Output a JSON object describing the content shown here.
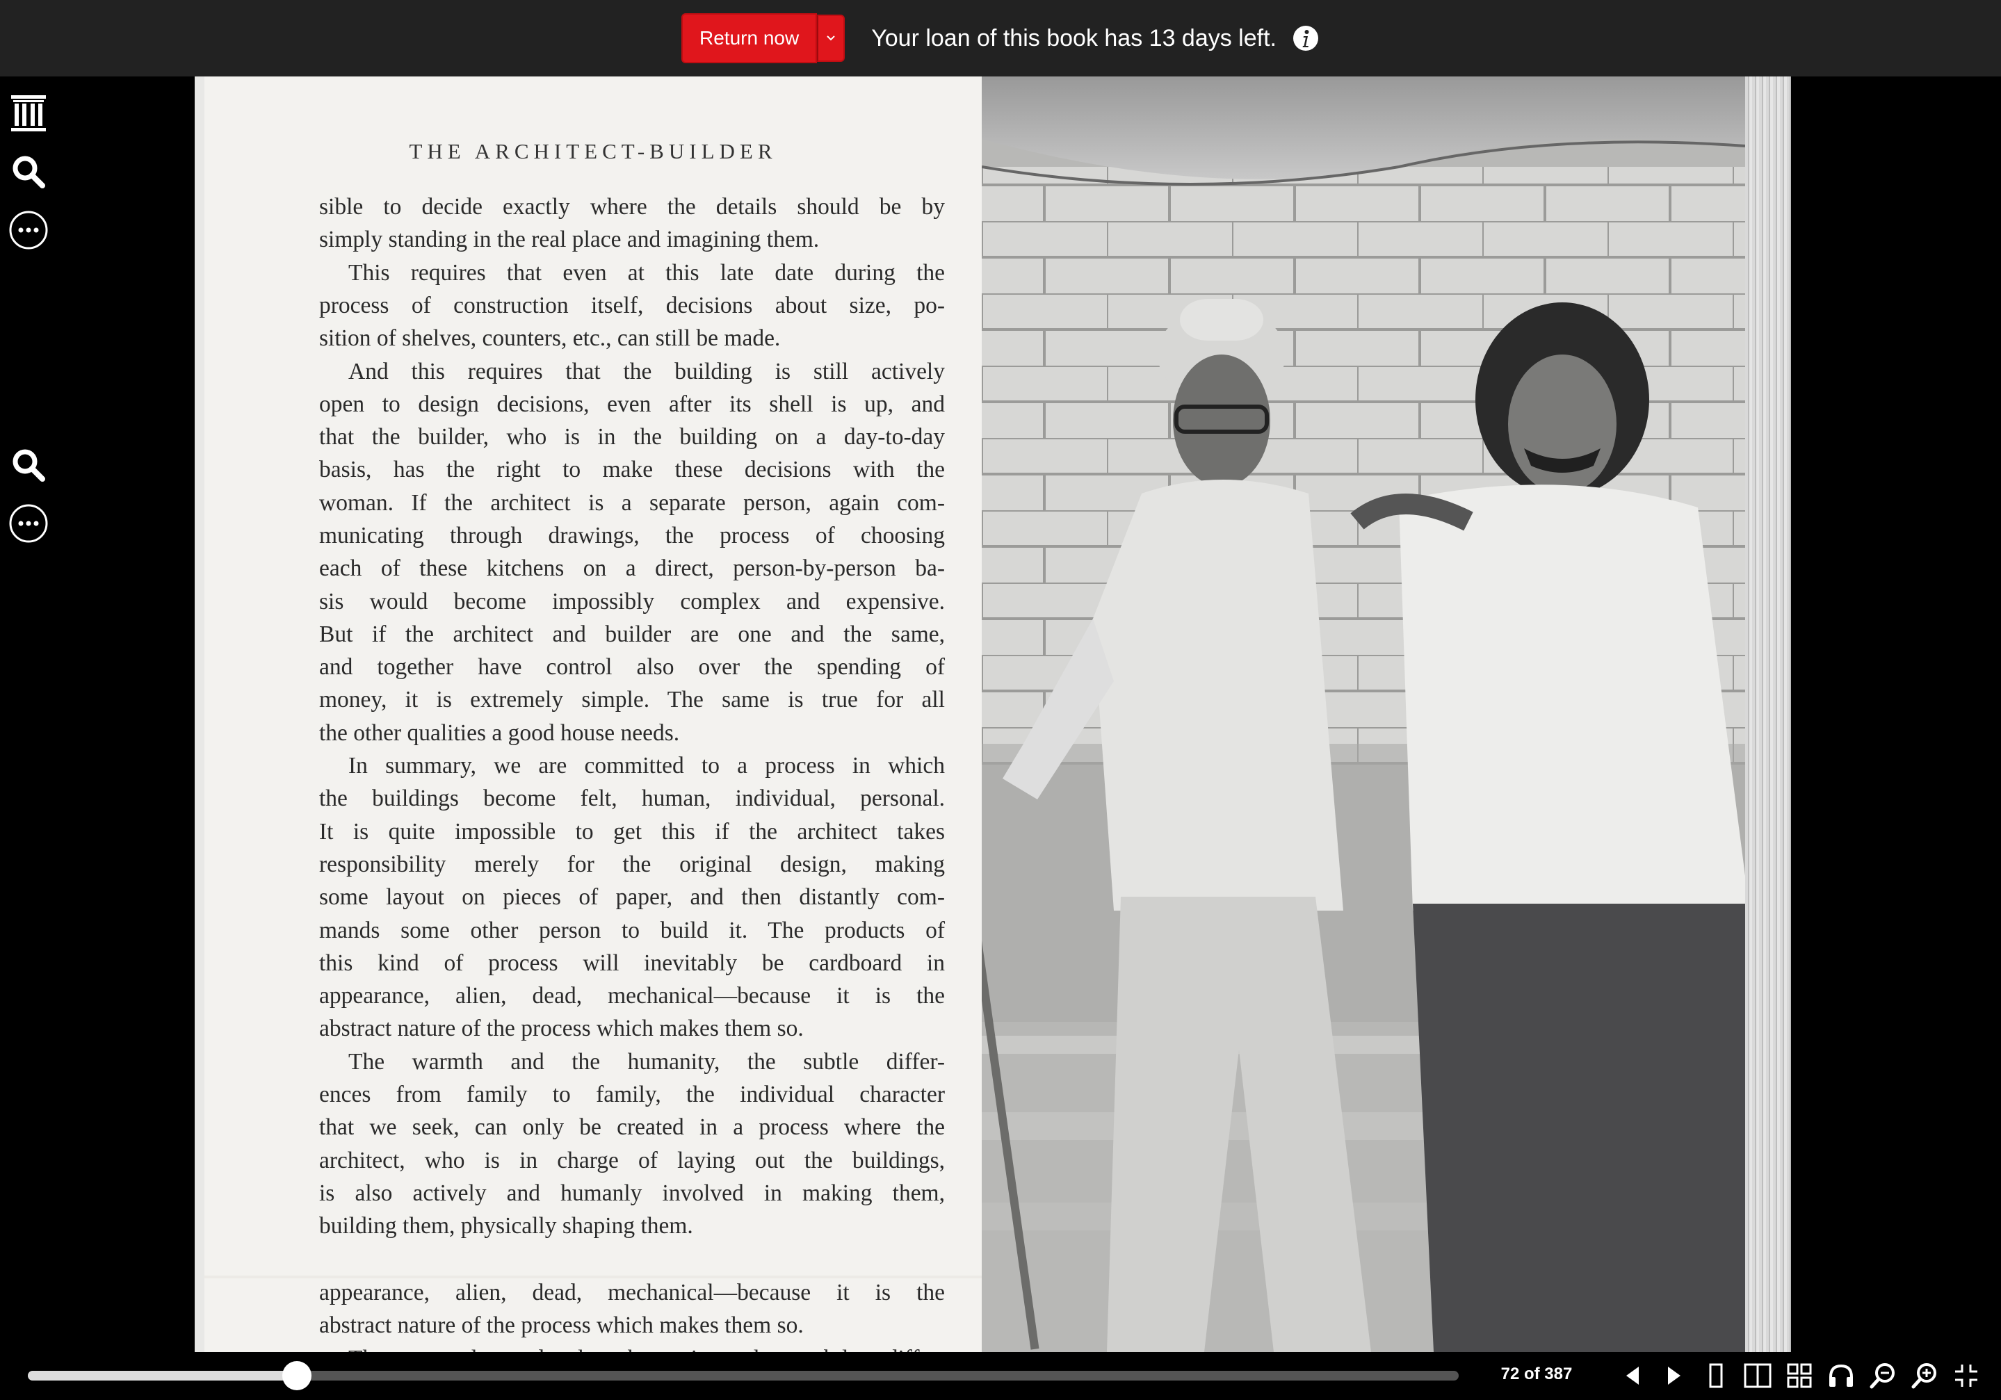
{
  "topbar": {
    "return_label": "Return now",
    "loan_message": "Your loan of this book has 13 days left."
  },
  "sidebar": {
    "icons": [
      "archive-logo-icon",
      "search-icon",
      "more-icon",
      "search-icon",
      "more-icon"
    ]
  },
  "book": {
    "heading": "THE ARCHITECT-BUILDER",
    "paragraphs": [
      [
        "sible to decide exactly where the details should be by",
        "simply standing in the real place and imagining them."
      ],
      [
        "This requires that even at this late date during the",
        "process of construction itself, decisions about size, po-",
        "sition of shelves, counters, etc., can still be made."
      ],
      [
        "And this requires that the building is still actively",
        "open to design decisions, even after its shell is up, and",
        "that the builder, who is in the building on a day-to-day",
        "basis, has the right to make these decisions with the",
        "woman. If the architect is a separate person, again com-",
        "municating through drawings, the process of choosing",
        "each of these kitchens on a direct, person-by-person ba-",
        "sis would become impossibly complex and expensive.",
        "But if the architect and builder are one and the same,",
        "and together have control also over the spending of",
        "money, it is extremely simple. The same is true for all",
        "the other qualities a good house needs."
      ],
      [
        "In summary, we are committed to a process in which",
        "the buildings become felt, human, individual, personal.",
        "It is quite impossible to get this if the architect takes",
        "responsibility merely for the original design, making",
        "some layout on pieces of paper, and then distantly com-",
        "mands some other person to build it. The products of",
        "this kind of process will inevitably be cardboard in",
        "appearance, alien, dead, mechanical—because it is the",
        "abstract nature of the process which makes them so."
      ],
      [
        "The warmth and the humanity, the subtle differ-",
        "ences from family to family, the individual character",
        "that we seek, can only be created in a process where the",
        "architect, who is in charge of laying out the buildings,",
        "is also actively and humanly involved in making them,",
        "building them, physically shaping them."
      ]
    ],
    "overflow_lines": [
      "appearance, alien, dead, mechanical—because it is the",
      "abstract nature of the process which makes them so.",
      "The warmth and the humanity, the subtle differ-"
    ]
  },
  "nav": {
    "page_label": "72 of 387",
    "progress_fraction": 0.188,
    "icons": [
      "prev-page-icon",
      "next-page-icon",
      "one-page-view-icon",
      "two-page-view-icon",
      "thumbnail-view-icon",
      "read-aloud-icon",
      "zoom-out-icon",
      "zoom-in-icon",
      "exit-fullscreen-icon"
    ]
  },
  "colors": {
    "return_button": "#e0161c",
    "topbar": "#222222"
  }
}
